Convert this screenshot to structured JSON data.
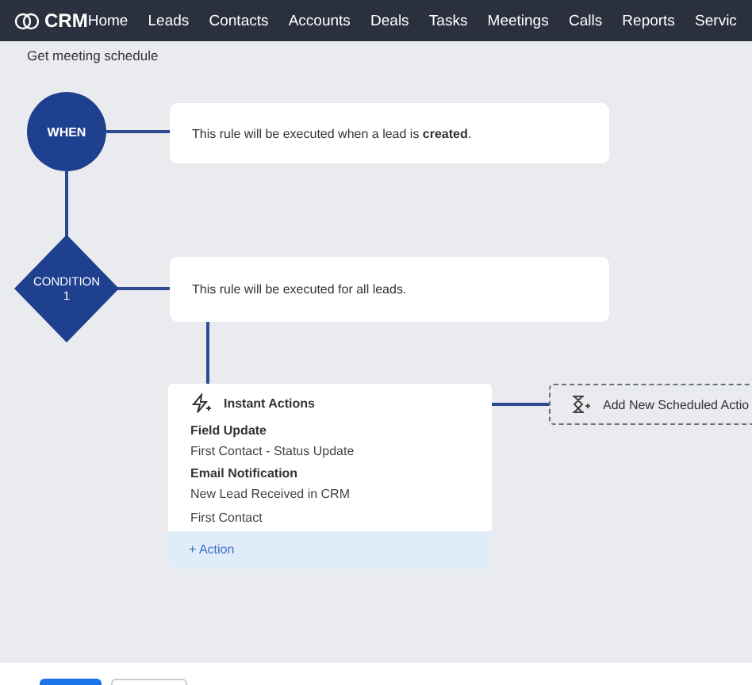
{
  "nav": {
    "logo": "CRM",
    "items": [
      "Home",
      "Leads",
      "Contacts",
      "Accounts",
      "Deals",
      "Tasks",
      "Meetings",
      "Calls",
      "Reports",
      "Servic"
    ]
  },
  "breadcrumb": "Get meeting schedule",
  "flow": {
    "trigger": {
      "label": "WHEN",
      "text": "This rule will be executed when a lead is **created**."
    },
    "condition": {
      "label": "CONDITION",
      "number": "1",
      "text": "This rule will be executed for all leads."
    },
    "instant_actions": {
      "title": "Instant Actions",
      "actions": [
        {
          "type": "Field Update",
          "details": [
            "First Contact - Status Update"
          ]
        },
        {
          "type": "Email Notification",
          "details": [
            "New Lead Received in CRM",
            "First Contact"
          ]
        }
      ],
      "add_label": "+ Action"
    },
    "scheduled": {
      "label": "Add New Scheduled Actio"
    }
  },
  "footer_buttons": [
    {
      "kind": "primary"
    },
    {
      "kind": "secondary"
    }
  ]
}
